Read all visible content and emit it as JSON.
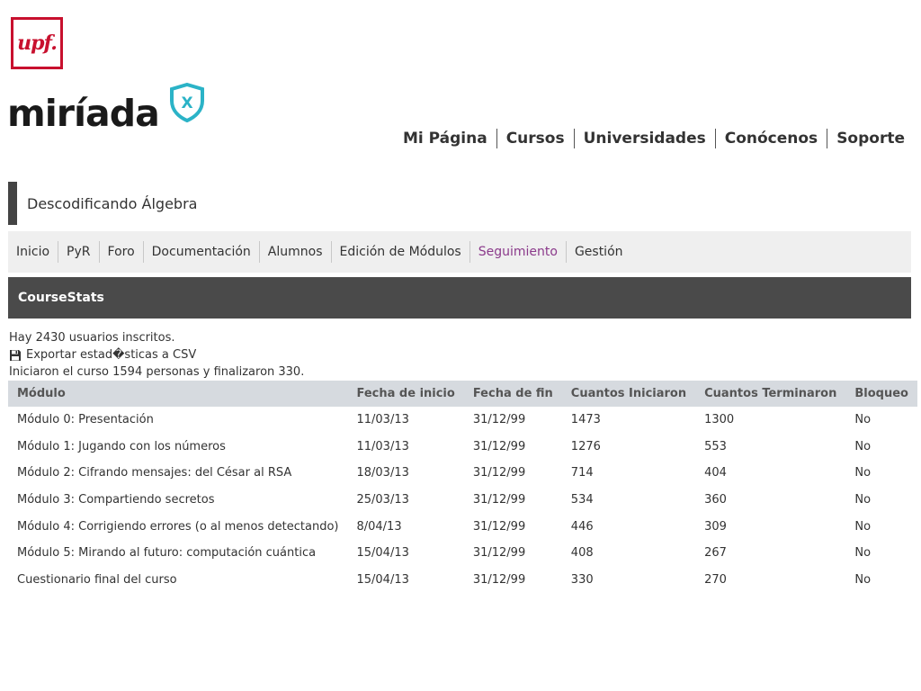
{
  "branding": {
    "upf_logo_text": "upf.",
    "miriada_wordmark": "miríada",
    "miriada_badge": "X"
  },
  "main_nav": {
    "items": [
      {
        "label": "Mi Página"
      },
      {
        "label": "Cursos"
      },
      {
        "label": "Universidades"
      },
      {
        "label": "Conócenos"
      },
      {
        "label": "Soporte"
      }
    ]
  },
  "course": {
    "title": "Descodificando Álgebra"
  },
  "sub_nav": {
    "items": [
      {
        "label": "Inicio"
      },
      {
        "label": "PyR"
      },
      {
        "label": "Foro"
      },
      {
        "label": "Documentación"
      },
      {
        "label": "Alumnos"
      },
      {
        "label": "Edición de Módulos"
      },
      {
        "label": "Seguimiento"
      },
      {
        "label": "Gestión"
      }
    ],
    "active_index": 6
  },
  "section": {
    "title": "CourseStats"
  },
  "info": {
    "enrolled": "Hay 2430 usuarios inscritos.",
    "export_label": "Exportar estad�sticas a CSV",
    "summary": "Iniciaron el curso 1594 personas y finalizaron 330."
  },
  "table": {
    "headers": [
      "Módulo",
      "Fecha de inicio",
      "Fecha de fin",
      "Cuantos Iniciaron",
      "Cuantos Terminaron",
      "Bloqueo"
    ],
    "rows": [
      [
        "Módulo 0: Presentación",
        "11/03/13",
        "31/12/99",
        "1473",
        "1300",
        "No"
      ],
      [
        "Módulo 1: Jugando con los números",
        "11/03/13",
        "31/12/99",
        "1276",
        "553",
        "No"
      ],
      [
        "Módulo 2: Cifrando mensajes: del César al RSA",
        "18/03/13",
        "31/12/99",
        "714",
        "404",
        "No"
      ],
      [
        "Módulo 3: Compartiendo secretos",
        "25/03/13",
        "31/12/99",
        "534",
        "360",
        "No"
      ],
      [
        "Módulo 4: Corrigiendo errores (o al menos detectando)",
        "8/04/13",
        "31/12/99",
        "446",
        "309",
        "No"
      ],
      [
        "Módulo 5: Mirando al futuro: computación cuántica",
        "15/04/13",
        "31/12/99",
        "408",
        "267",
        "No"
      ],
      [
        "Cuestionario final del curso",
        "15/04/13",
        "31/12/99",
        "330",
        "270",
        "No"
      ]
    ]
  },
  "colors": {
    "upf_red": "#c8102e",
    "miriada_teal": "#2bb3c7",
    "active_tab": "#8b3a8b",
    "section_bar": "#4a4a4a",
    "table_header": "#d6dadf"
  }
}
